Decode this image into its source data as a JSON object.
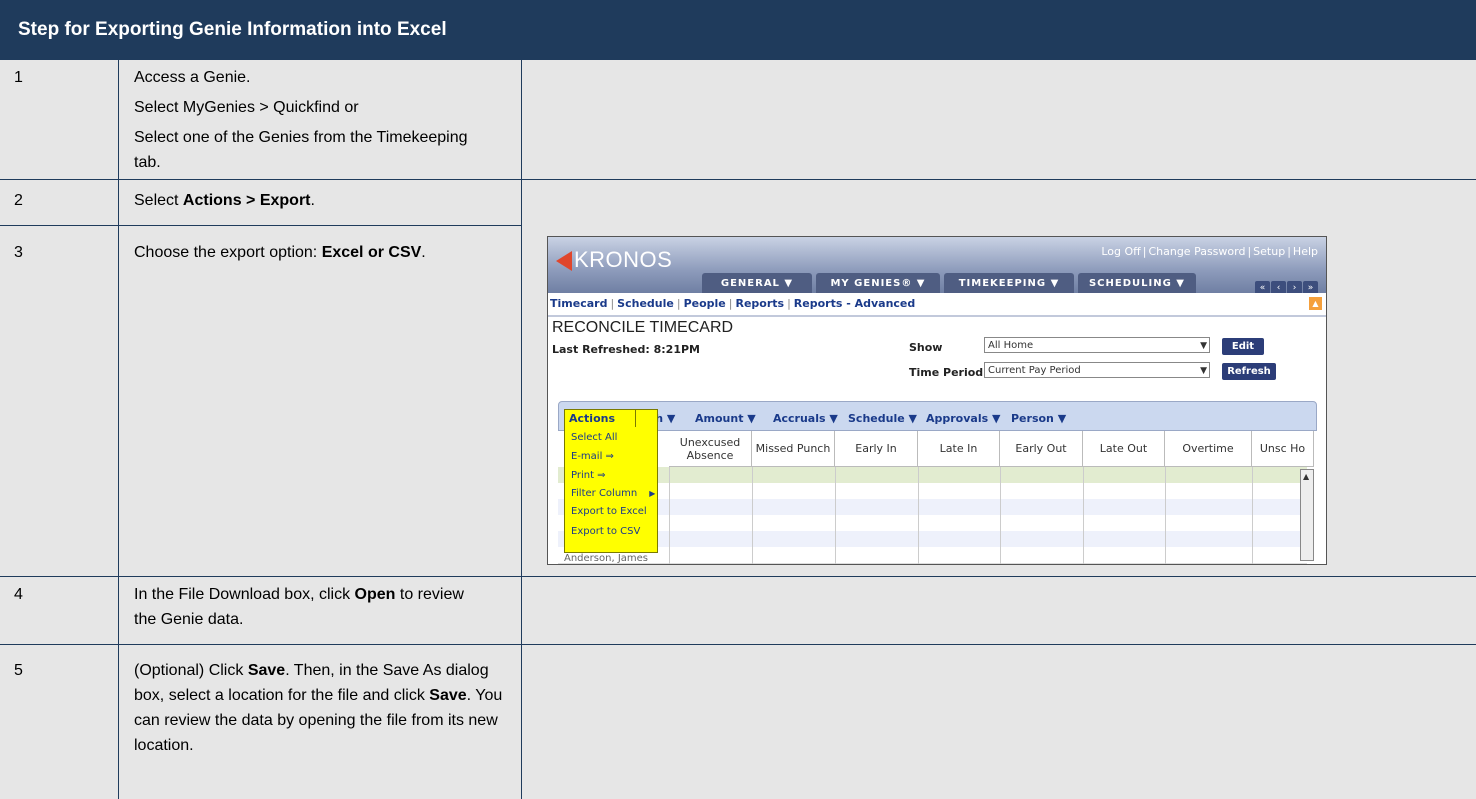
{
  "header": {
    "title": "Step for Exporting Genie Information into Excel"
  },
  "rows": [
    {
      "num": "1",
      "lines": [
        "Access a Genie.",
        "Select MyGenies > Quickfind or",
        "Select one of the Genies from the Timekeeping tab."
      ]
    },
    {
      "num": "2",
      "pre": "Select ",
      "bold": "Actions > Export",
      "post": "."
    },
    {
      "num": "3",
      "pre": "Choose the export option: ",
      "bold": "Excel or CSV",
      "post": "."
    },
    {
      "num": "4",
      "pre": "In the File Download box, click ",
      "bold": "Open",
      "post": " to review the Genie data."
    },
    {
      "num": "5",
      "pre": "(Optional) Click ",
      "bold": "Save",
      "mid": ". Then, in the Save As dialog box, select a location for the file and click ",
      "bold2": "Save",
      "post": ". You can review the data by opening the file from its new location."
    }
  ],
  "kronos": {
    "logo": "KRONOS",
    "top_links": [
      "Log Off",
      "Change Password",
      "Setup",
      "Help"
    ],
    "tabs": [
      "GENERAL ▼",
      "MY GENIES® ▼",
      "TIMEKEEPING ▼",
      "SCHEDULING ▼"
    ],
    "nav_arrows": [
      "«",
      "‹",
      "›",
      "»"
    ],
    "subnav": [
      "Timecard",
      "Schedule",
      "People",
      "Reports",
      "Reports - Advanced"
    ],
    "title": "RECONCILE TIMECARD",
    "last_refreshed": "Last Refreshed: 8:21PM",
    "show_label": "Show",
    "show_value": "All Home",
    "period_label": "Time Period",
    "period_value": "Current Pay Period",
    "edit_button": "Edit",
    "refresh_button": "Refresh",
    "toolbar": [
      "Punch ▼",
      "Amount ▼",
      "Accruals ▼",
      "Schedule ▼",
      "Approvals ▼",
      "Person ▼"
    ],
    "columns": [
      "Unexcused Absence",
      "Missed Punch",
      "Early In",
      "Late In",
      "Early Out",
      "Late Out",
      "Overtime",
      "Unsc Ho"
    ],
    "actions_menu": {
      "title": "Actions",
      "items": [
        "Select All",
        "E-mail ⇒",
        "Print ⇒",
        "Filter Column",
        "Export to Excel",
        "Export to CSV"
      ]
    },
    "cutoff_row_text": "Anderson, James"
  }
}
